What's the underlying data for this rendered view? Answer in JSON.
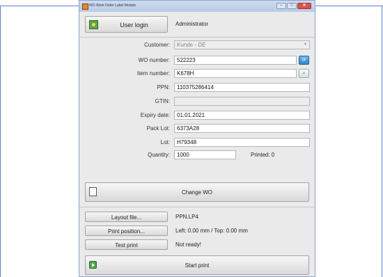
{
  "window": {
    "title": "WO Work Order Label Module",
    "controls": {
      "minimize": "–",
      "maximize": "□",
      "close": "✕"
    }
  },
  "header": {
    "login_label": "User login",
    "user": "Administrator"
  },
  "form": {
    "customer": {
      "label": "Customer:",
      "value": "Kunde - DE"
    },
    "wo_number": {
      "label": "WO number:",
      "value": "522223"
    },
    "item_number": {
      "label": "Item number:",
      "value": "K678H"
    },
    "ppn": {
      "label": "PPN:",
      "value": "110375286414"
    },
    "gtin": {
      "label": "GTIN:",
      "value": ""
    },
    "expiry_date": {
      "label": "Expiry date:",
      "value": "01.01.2021"
    },
    "pack_lot": {
      "label": "Pack Lot:",
      "value": "6373A28"
    },
    "lot": {
      "label": "Lot:",
      "value": "H79348"
    },
    "quantity": {
      "label": "Quantity:",
      "value": "1000"
    },
    "printed": "Printed: 0"
  },
  "actions": {
    "change_wo": "Change WO",
    "layout_file": {
      "label": "Layout file...",
      "value": "PPN.LP4"
    },
    "print_position": {
      "label": "Print position...",
      "value": "Left: 0.00 mm / Top: 0.00 mm"
    },
    "test_print": {
      "label": "Test print",
      "value": "Not ready!"
    },
    "start_print": "Start print"
  },
  "icons": {
    "app": "app-icon",
    "login": "user-login-icon",
    "refresh": "refresh-icon",
    "search": "search-icon",
    "change_wo": "document-icon",
    "start_print": "play-icon"
  },
  "colors": {
    "frame": "#5b7fc7",
    "window_bg": "#eaeaea",
    "refresh_button": "#2f86c9",
    "start_icon": "#4fa84a"
  }
}
